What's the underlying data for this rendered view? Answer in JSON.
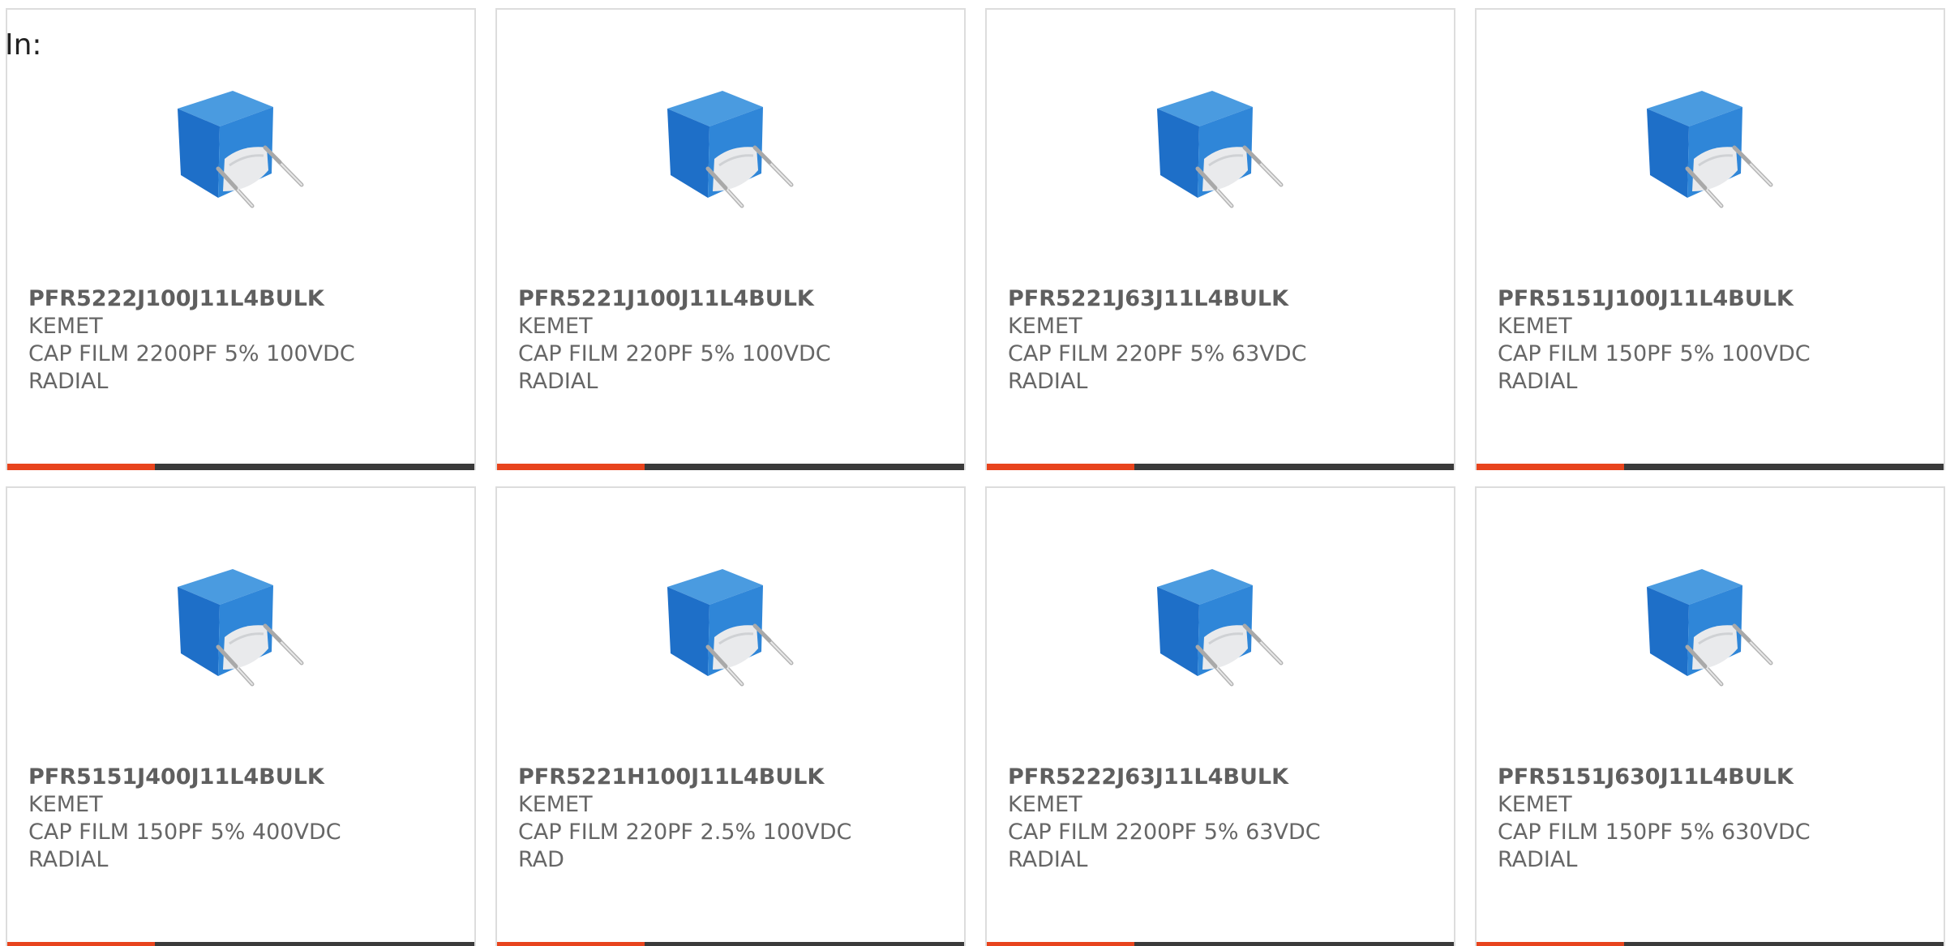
{
  "header": {
    "label": "In:"
  },
  "colors": {
    "accent": "#e8441d",
    "bar": "#3a3a3a",
    "border": "#dddddd",
    "text": "#666666"
  },
  "products": [
    {
      "part_number": "PFR5222J100J11L4BULK",
      "manufacturer": "KEMET",
      "desc_line1": "CAP FILM 2200PF 5% 100VDC",
      "desc_line2": "RADIAL",
      "image_icon": "film-capacitor-image"
    },
    {
      "part_number": "PFR5221J100J11L4BULK",
      "manufacturer": "KEMET",
      "desc_line1": "CAP FILM 220PF 5% 100VDC",
      "desc_line2": "RADIAL",
      "image_icon": "film-capacitor-image"
    },
    {
      "part_number": "PFR5221J63J11L4BULK",
      "manufacturer": "KEMET",
      "desc_line1": "CAP FILM 220PF 5% 63VDC",
      "desc_line2": "RADIAL",
      "image_icon": "film-capacitor-image"
    },
    {
      "part_number": "PFR5151J100J11L4BULK",
      "manufacturer": "KEMET",
      "desc_line1": "CAP FILM 150PF 5% 100VDC",
      "desc_line2": "RADIAL",
      "image_icon": "film-capacitor-image"
    },
    {
      "part_number": "PFR5151J400J11L4BULK",
      "manufacturer": "KEMET",
      "desc_line1": "CAP FILM 150PF 5% 400VDC",
      "desc_line2": "RADIAL",
      "image_icon": "film-capacitor-image"
    },
    {
      "part_number": "PFR5221H100J11L4BULK",
      "manufacturer": "KEMET",
      "desc_line1": "CAP FILM 220PF 2.5% 100VDC",
      "desc_line2": "RAD",
      "image_icon": "film-capacitor-image"
    },
    {
      "part_number": "PFR5222J63J11L4BULK",
      "manufacturer": "KEMET",
      "desc_line1": "CAP FILM 2200PF 5% 63VDC",
      "desc_line2": "RADIAL",
      "image_icon": "film-capacitor-image"
    },
    {
      "part_number": "PFR5151J630J11L4BULK",
      "manufacturer": "KEMET",
      "desc_line1": "CAP FILM 150PF 5% 630VDC",
      "desc_line2": "RADIAL",
      "image_icon": "film-capacitor-image"
    }
  ]
}
